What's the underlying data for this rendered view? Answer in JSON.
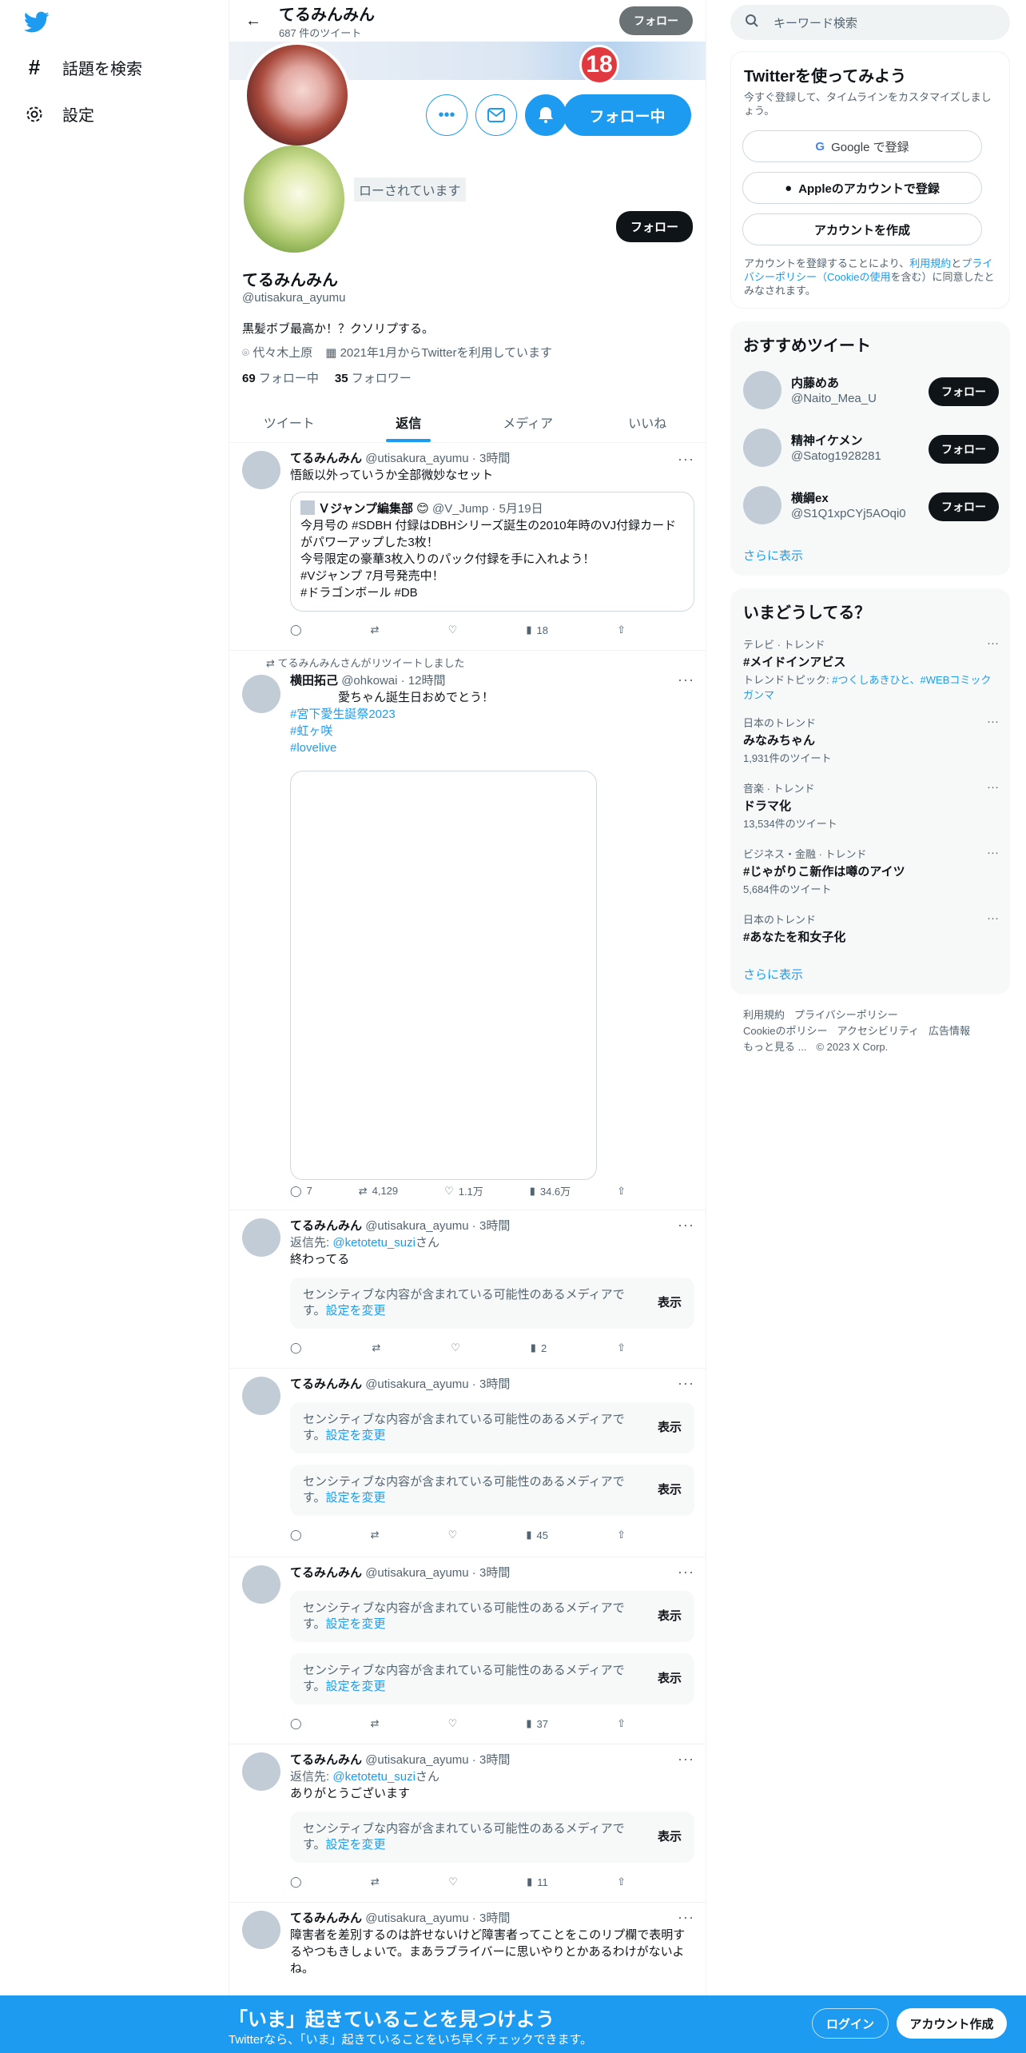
{
  "nav": {
    "explore": "話題を検索",
    "settings": "設定"
  },
  "header": {
    "name": "てるみんみん",
    "tweet_count": "687 件のツイート",
    "follow": "フォロー"
  },
  "banner": {
    "badge": "18"
  },
  "profile": {
    "following_button": "フォロー中",
    "followed_text": "ローされています",
    "follow_button": "フォロー",
    "name": "てるみんみん",
    "handle": "@utisakura_ayumu",
    "bio": "黒髪ボブ最高か！？クソリプする。",
    "location": "代々木上原",
    "joined": "2021年1月からTwitterを利用しています",
    "following_count": "69",
    "following_label": "フォロー中",
    "followers_count": "35",
    "followers_label": "フォロワー"
  },
  "tabs": [
    "ツイート",
    "返信",
    "メディア",
    "いいね"
  ],
  "tweets": [
    {
      "name": "てるみんみん",
      "meta": "@utisakura_ayumu · 3時間",
      "text": "悟飯以外っていうか全部微妙なセット",
      "quote": {
        "name": "Ｖジャンプ編集部",
        "meta": "@V_Jump · 5月19日",
        "text": "今月号の #SDBH 付録はDBHシリーズ誕生の2010年時のVJ付録カードがパワーアップした3枚！\n今号限定の豪華3枚入りのパック付録を手に入れよう！\n#Vジャンプ 7月号発売中！\n#ドラゴンボール #DB"
      },
      "views": "18"
    },
    {
      "retweet_label": "てるみんみんさんがリツイートしました",
      "name": "横田拓己",
      "meta": "@ohkowai · 12時間",
      "text": "愛ちゃん誕生日おめでとう！",
      "tags": [
        "#宮下愛生誕祭2023",
        "#虹ヶ咲",
        "#lovelive"
      ],
      "replies": "7",
      "retweets": "4,129",
      "likes": "1.1万",
      "views": "34.6万"
    },
    {
      "name": "てるみんみん",
      "meta": "@utisakura_ayumu · 3時間",
      "reply_prefix": "返信先: ",
      "reply_to": "@ketotetu_suzi",
      "reply_suffix": "さん",
      "text": "終わってる",
      "views": "2"
    },
    {
      "name": "てるみんみん",
      "meta": "@utisakura_ayumu · 3時間",
      "views": "45"
    },
    {
      "name": "てるみんみん",
      "meta": "@utisakura_ayumu · 3時間",
      "views": "37"
    },
    {
      "name": "てるみんみん",
      "meta": "@utisakura_ayumu · 3時間",
      "reply_prefix": "返信先: ",
      "reply_to": "@ketotetu_suzi",
      "reply_suffix": "さん",
      "text": "ありがとうございます",
      "views": "11"
    },
    {
      "name": "てるみんみん",
      "meta": "@utisakura_ayumu · 3時間",
      "text": "障害者を差別するのは許せないけど障害者ってことをこのリプ欄で表明するやつもきしょいで。まあラブライバーに思いやりとかあるわけがないよね。"
    }
  ],
  "sensitive": {
    "text": "センシティブな内容が含まれている可能性のあるメディアです。",
    "link": "設定を変更",
    "show": "表示"
  },
  "search": {
    "placeholder": "キーワード検索"
  },
  "signup": {
    "title": "Twitterを使ってみよう",
    "sub": "今すぐ登録して、タイムラインをカスタマイズしましょう。",
    "google": "Google で登録",
    "apple": "Appleのアカウントで登録",
    "create": "アカウントを作成",
    "legal_1": "アカウントを登録することにより、",
    "legal_terms": "利用規約",
    "legal_2": "と",
    "legal_privacy": "プライバシーポリシー（Cookieの使用",
    "legal_3": "を含む）に同意したとみなされます。"
  },
  "recommended": {
    "title": "おすすめツイート",
    "users": [
      {
        "name": "内藤めあ",
        "handle": "@Naito_Mea_U",
        "follow": "フォロー"
      },
      {
        "name": "精神イケメン",
        "handle": "@Satog1928281",
        "follow": "フォロー"
      },
      {
        "name": "横綱ex",
        "handle": "@S1Q1xpCYj5AOqi0",
        "follow": "フォロー"
      }
    ],
    "more": "さらに表示"
  },
  "trends": {
    "title": "いまどうしてる？",
    "items": [
      {
        "category": "テレビ · トレンド",
        "name": "#メイドインアビス",
        "extra_prefix": "トレンドトピック: ",
        "extra_links": "#つくしあきひと、#WEBコミックガンマ"
      },
      {
        "category": "日本のトレンド",
        "name": "みなみちゃん",
        "count": "1,931件のツイート"
      },
      {
        "category": "音楽 · トレンド",
        "name": "ドラマ化",
        "count": "13,534件のツイート"
      },
      {
        "category": "ビジネス・金融 · トレンド",
        "name": "#じゃがりこ新作は噂のアイツ",
        "count": "5,684件のツイート"
      },
      {
        "category": "日本のトレンド",
        "name": "#あなたを和女子化"
      }
    ],
    "more": "さらに表示"
  },
  "footer": {
    "links": [
      "利用規約",
      "プライバシーポリシー",
      "Cookieのポリシー",
      "アクセシビリティ",
      "広告情報",
      "もっと見る ..."
    ],
    "copyright": "© 2023 X Corp."
  },
  "bottom_bar": {
    "title": "「いま」起きていることを見つけよう",
    "sub": "Twitterなら、「いま」起きていることをいち早くチェックできます。",
    "login": "ログイン",
    "signup": "アカウント作成"
  }
}
